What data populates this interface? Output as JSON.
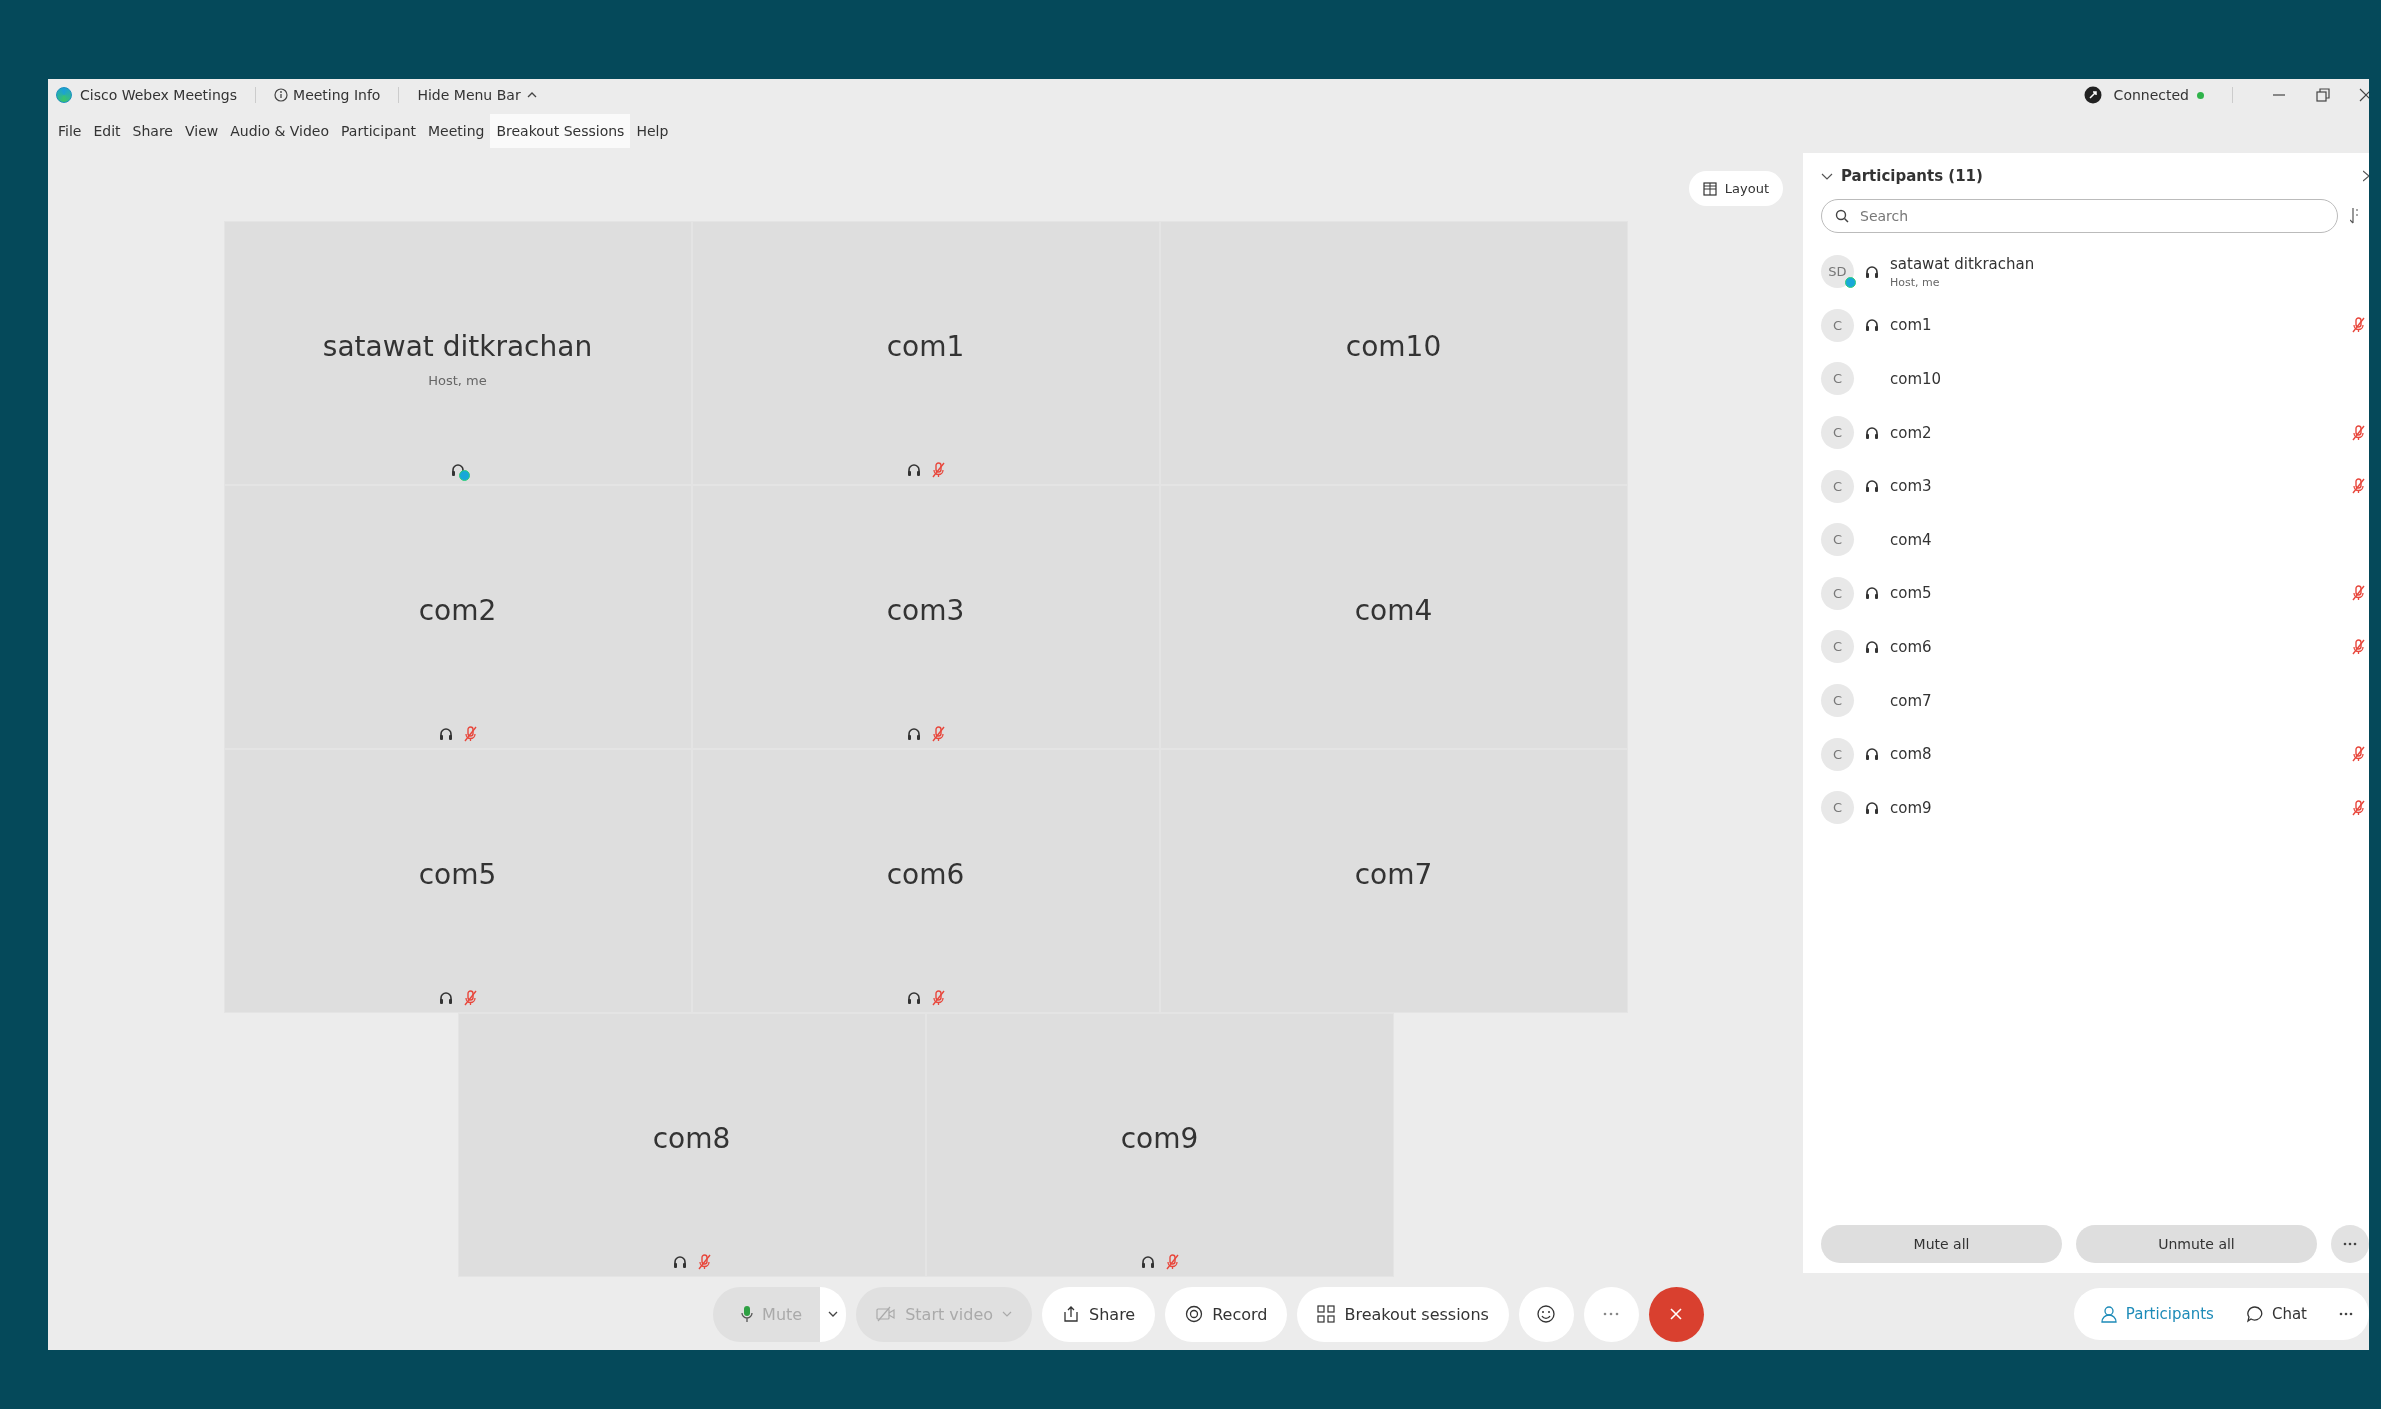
{
  "title_bar": {
    "app_name": "Cisco Webex Meetings",
    "meeting_info": "Meeting Info",
    "hide_menu": "Hide Menu Bar",
    "status": "Connected"
  },
  "menu": [
    {
      "label": "File",
      "selected": false
    },
    {
      "label": "Edit",
      "selected": false
    },
    {
      "label": "Share",
      "selected": false
    },
    {
      "label": "View",
      "selected": false
    },
    {
      "label": "Audio & Video",
      "selected": false
    },
    {
      "label": "Participant",
      "selected": false
    },
    {
      "label": "Meeting",
      "selected": false
    },
    {
      "label": "Breakout Sessions",
      "selected": true
    },
    {
      "label": "Help",
      "selected": false
    }
  ],
  "layout_button": "Layout",
  "tiles": [
    {
      "name": "satawat ditkrachan",
      "subtitle": "Host, me",
      "audio": true,
      "muted": false,
      "self": true
    },
    {
      "name": "com1",
      "audio": true,
      "muted": true,
      "self": false
    },
    {
      "name": "com10",
      "audio": false,
      "muted": false,
      "self": false
    },
    {
      "name": "com2",
      "audio": true,
      "muted": true,
      "self": false
    },
    {
      "name": "com3",
      "audio": true,
      "muted": true,
      "self": false
    },
    {
      "name": "com4",
      "audio": false,
      "muted": false,
      "self": false
    },
    {
      "name": "com5",
      "audio": true,
      "muted": true,
      "self": false
    },
    {
      "name": "com6",
      "audio": true,
      "muted": true,
      "self": false
    },
    {
      "name": "com7",
      "audio": false,
      "muted": false,
      "self": false
    },
    {
      "name": "com8",
      "audio": true,
      "muted": true,
      "self": false
    },
    {
      "name": "com9",
      "audio": true,
      "muted": true,
      "self": false
    }
  ],
  "participants_panel": {
    "title": "Participants (11)",
    "search": {
      "placeholder": "Search"
    },
    "participants": [
      {
        "initials": "SD",
        "name": "satawat ditkrachan",
        "subtitle": "Host, me",
        "audio": true,
        "muted": false,
        "self": true
      },
      {
        "initials": "C",
        "name": "com1",
        "audio": true,
        "muted": true,
        "self": false
      },
      {
        "initials": "C",
        "name": "com10",
        "audio": false,
        "muted": false,
        "self": false
      },
      {
        "initials": "C",
        "name": "com2",
        "audio": true,
        "muted": true,
        "self": false
      },
      {
        "initials": "C",
        "name": "com3",
        "audio": true,
        "muted": true,
        "self": false
      },
      {
        "initials": "C",
        "name": "com4",
        "audio": false,
        "muted": false,
        "self": false
      },
      {
        "initials": "C",
        "name": "com5",
        "audio": true,
        "muted": true,
        "self": false
      },
      {
        "initials": "C",
        "name": "com6",
        "audio": true,
        "muted": true,
        "self": false
      },
      {
        "initials": "C",
        "name": "com7",
        "audio": false,
        "muted": false,
        "self": false
      },
      {
        "initials": "C",
        "name": "com8",
        "audio": true,
        "muted": true,
        "self": false
      },
      {
        "initials": "C",
        "name": "com9",
        "audio": true,
        "muted": true,
        "self": false
      }
    ],
    "buttons": [
      "Mute all",
      "Unmute all"
    ]
  },
  "toolbar": [
    {
      "kind": "mute",
      "label": "Mute",
      "disabled": true
    },
    {
      "kind": "video",
      "label": "Start video",
      "disabled": true
    },
    {
      "kind": "share",
      "label": "Share",
      "disabled": false
    },
    {
      "kind": "record",
      "label": "Record",
      "disabled": false
    },
    {
      "kind": "breakout",
      "label": "Breakout sessions",
      "disabled": false
    },
    {
      "kind": "reactions",
      "disabled": false
    },
    {
      "kind": "more",
      "disabled": false
    },
    {
      "kind": "end",
      "disabled": false
    }
  ],
  "panel_tabs": [
    {
      "kind": "participants",
      "label": "Participants",
      "selected": true
    },
    {
      "kind": "chat",
      "label": "Chat",
      "selected": false
    }
  ]
}
